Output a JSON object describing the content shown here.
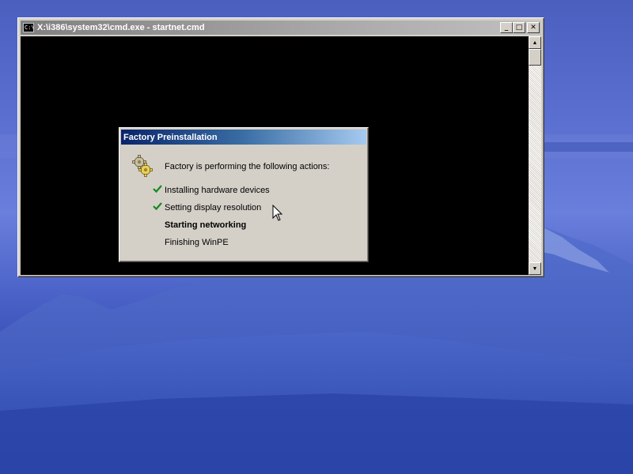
{
  "console_window": {
    "title": "X:\\i386\\system32\\cmd.exe - startnet.cmd",
    "icon": "console-app-icon",
    "icon_text": "C:\\",
    "minimize_glyph": "_",
    "maximize_glyph": "□",
    "close_glyph": "✕",
    "scroll_up_glyph": "▲",
    "scroll_down_glyph": "▼"
  },
  "dialog": {
    "title": "Factory Preinstallation",
    "icon": "gears-icon",
    "header": "Factory is performing the following actions:",
    "steps": [
      {
        "label": "Installing hardware devices",
        "status": "completed"
      },
      {
        "label": "Setting display resolution",
        "status": "completed"
      },
      {
        "label": "Starting networking",
        "status": "in-progress"
      },
      {
        "label": "Finishing WinPE",
        "status": "pending"
      }
    ]
  },
  "colors": {
    "active_title_start": "#0a246a",
    "active_title_end": "#a6caf0",
    "inactive_title": "#808080",
    "face": "#d4d0c8",
    "check_green": "#138a1e",
    "console_bg": "#000000"
  }
}
